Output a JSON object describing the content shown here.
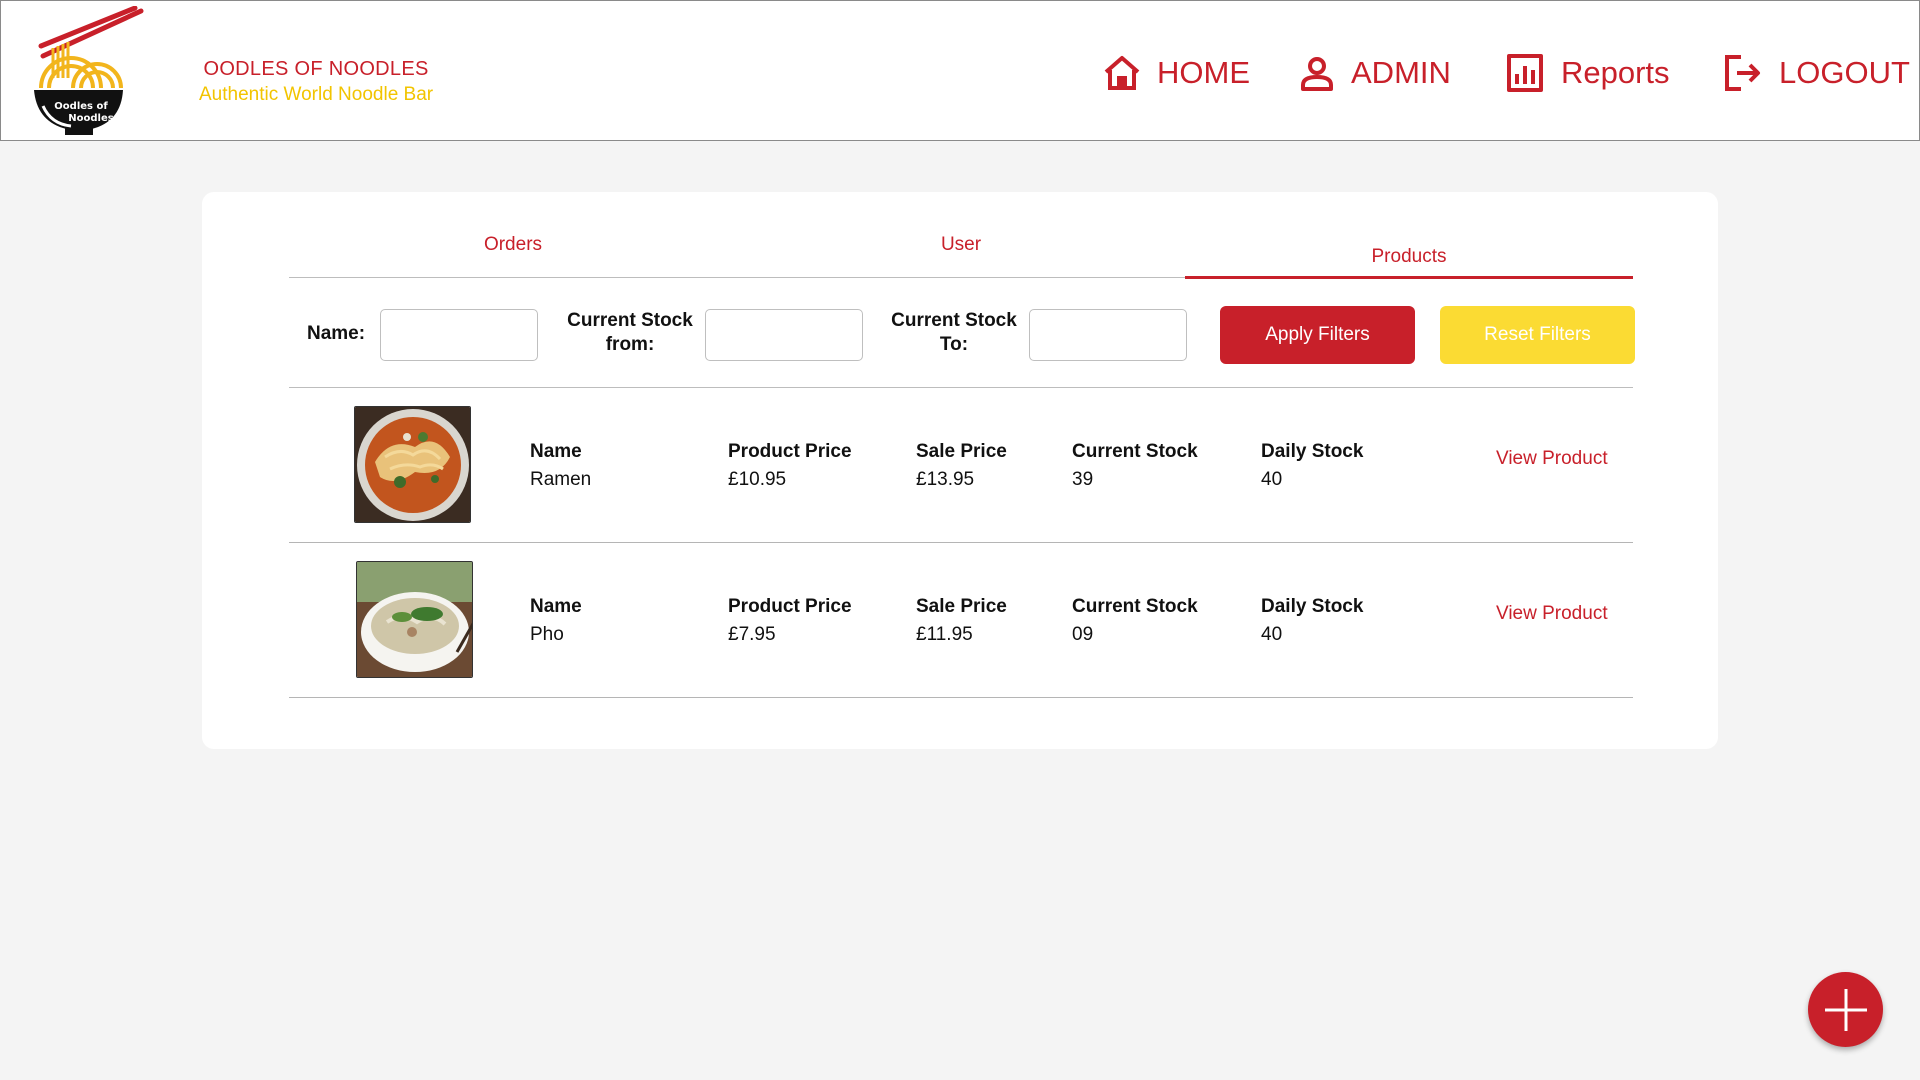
{
  "brand": {
    "logo_text_line1": "Oodles of",
    "logo_text_line2": "Noodles",
    "name": "OODLES OF NOODLES",
    "tagline": "Authentic World Noodle Bar"
  },
  "nav": {
    "home": "HOME",
    "admin": "ADMIN",
    "reports": "Reports",
    "logout": "LOGOUT"
  },
  "tabs": {
    "orders": "Orders",
    "user": "User",
    "products": "Products",
    "active": "Products"
  },
  "filters": {
    "name_label": "Name:",
    "stock_from_label_1": "Current Stock",
    "stock_from_label_2": "from:",
    "stock_to_label_1": "Current Stock",
    "stock_to_label_2": "To:",
    "name_value": "",
    "stock_from_value": "",
    "stock_to_value": "",
    "apply_label": "Apply Filters",
    "reset_label": "Reset Filters"
  },
  "columns": {
    "name": "Name",
    "product_price": "Product Price",
    "sale_price": "Sale Price",
    "current_stock": "Current Stock",
    "daily_stock": "Daily Stock"
  },
  "products": [
    {
      "name": "Ramen",
      "product_price": "£10.95",
      "sale_price": "£13.95",
      "current_stock": "39",
      "daily_stock": "40",
      "action": "View Product"
    },
    {
      "name": "Pho",
      "product_price": "£7.95",
      "sale_price": "£11.95",
      "current_stock": "09",
      "daily_stock": "40",
      "action": "View Product"
    }
  ],
  "colors": {
    "primary": "#c8202a",
    "accent": "#fbdb33",
    "tagline": "#f2c400",
    "background": "#f4f4f4"
  },
  "icons": {
    "home": "home-icon",
    "admin": "person-icon",
    "reports": "bar-chart-icon",
    "logout": "logout-icon",
    "fab": "plus-icon"
  }
}
